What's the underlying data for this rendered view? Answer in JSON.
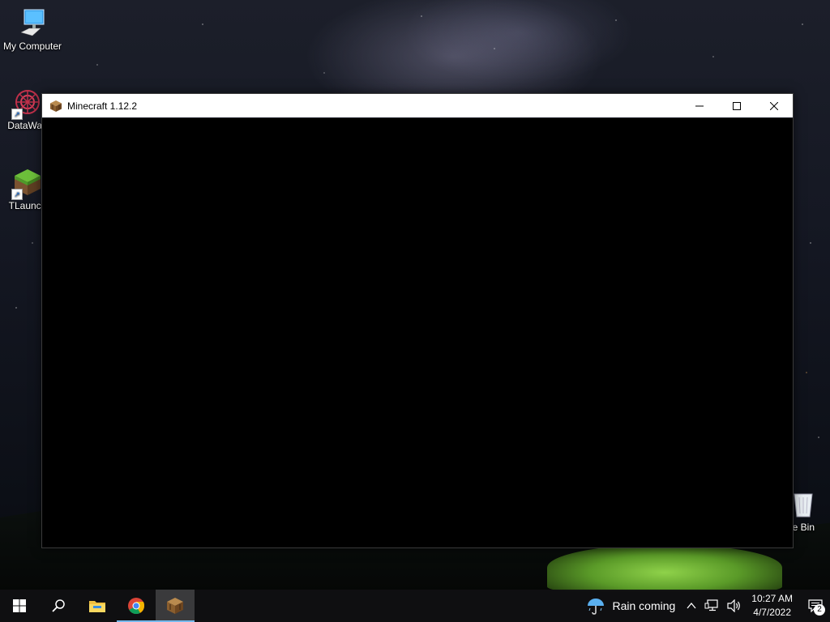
{
  "desktop": {
    "icons": [
      {
        "label": "My Computer",
        "icon": "monitor-icon"
      },
      {
        "label": "DataWag",
        "icon": "datawag-logo-icon"
      },
      {
        "label": "TLaunch",
        "icon": "grass-block-icon"
      },
      {
        "label": "le Bin",
        "icon": "recycle-bin-icon"
      }
    ]
  },
  "window": {
    "title": "Minecraft 1.12.2",
    "icon": "crafting-table-icon",
    "controls": [
      "minimize",
      "maximize",
      "close"
    ]
  },
  "taskbar": {
    "apps": [
      {
        "name": "start",
        "icon": "windows-logo-icon"
      },
      {
        "name": "search",
        "icon": "search-icon"
      },
      {
        "name": "file-explorer",
        "icon": "folder-icon"
      },
      {
        "name": "chrome",
        "icon": "chrome-icon"
      },
      {
        "name": "minecraft",
        "icon": "crafting-table-icon",
        "active": true
      }
    ],
    "weather": {
      "label": "Rain coming",
      "icon": "umbrella-icon"
    },
    "clock": {
      "time": "10:27 AM",
      "date": "4/7/2022"
    },
    "notifications": {
      "count": "2"
    }
  },
  "colors": {
    "taskbar_active": "#3a3a3c",
    "taskbar_indicator": "#76b9ed",
    "window_content": "#000000"
  }
}
